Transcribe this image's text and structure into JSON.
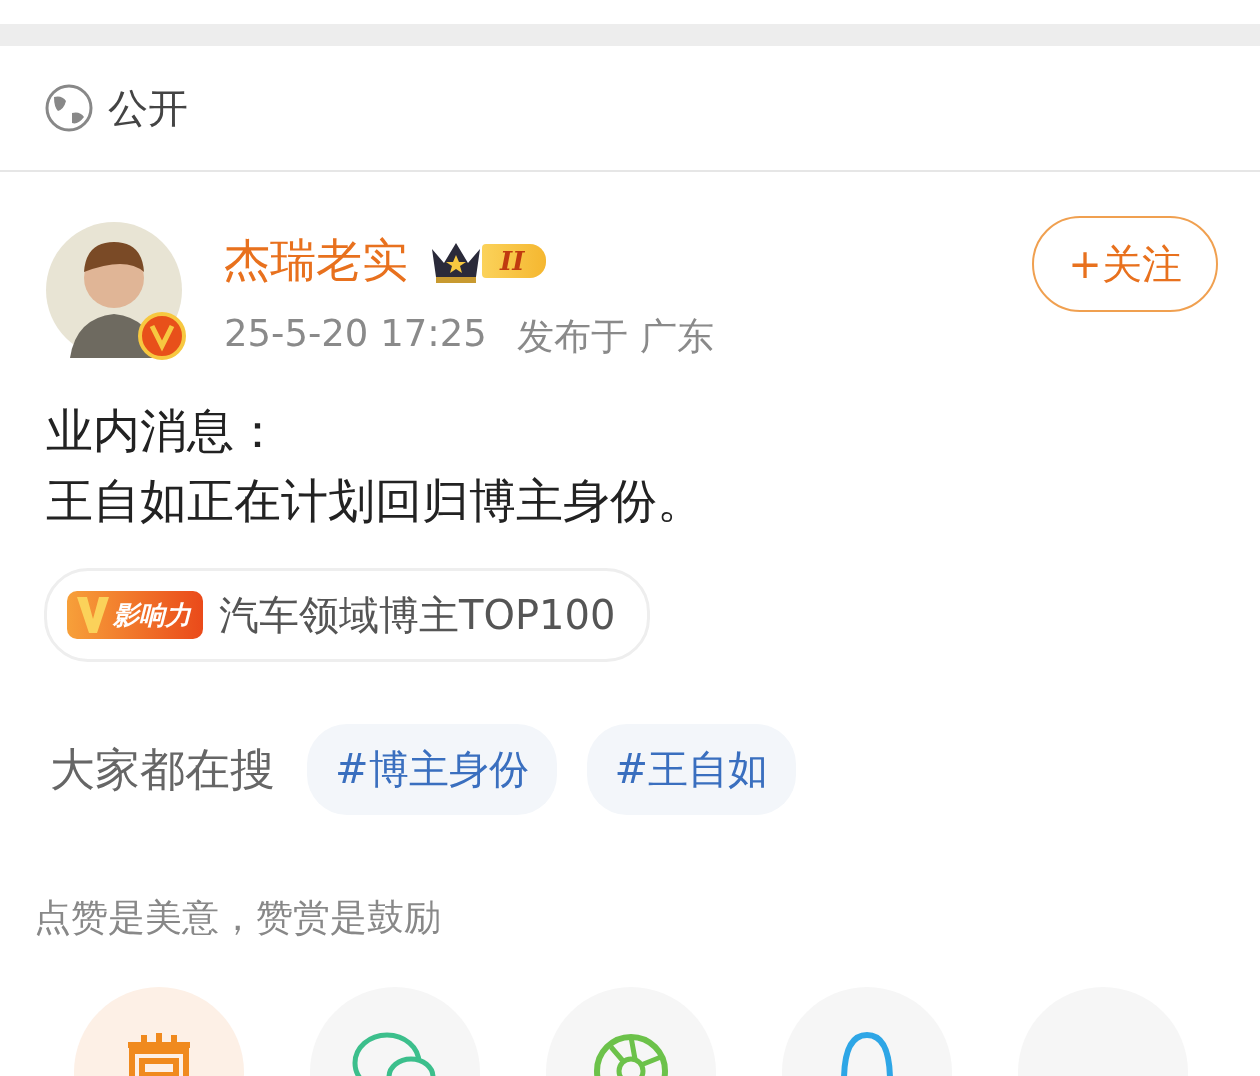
{
  "visibility": {
    "label": "公开"
  },
  "author": {
    "name": "杰瑞老实",
    "level": "II",
    "verified": true,
    "time": "25-5-20 17:25",
    "location": "发布于 广东",
    "follow": "+关注"
  },
  "post": {
    "lines": [
      "业内消息：",
      "王自如正在计划回归博主身份。"
    ]
  },
  "influence": {
    "badge": "影响力",
    "text": "汽车领域博主TOP100"
  },
  "searches": {
    "label": "大家都在搜",
    "topics": [
      "#博主身份",
      "#王自如"
    ]
  },
  "reward": {
    "hint": "点赞是美意，赞赏是鼓励"
  },
  "share_targets": [
    {
      "kind": "reward"
    },
    {
      "kind": "wechat"
    },
    {
      "kind": "moments"
    },
    {
      "kind": "qq"
    },
    {
      "kind": "other"
    }
  ]
}
